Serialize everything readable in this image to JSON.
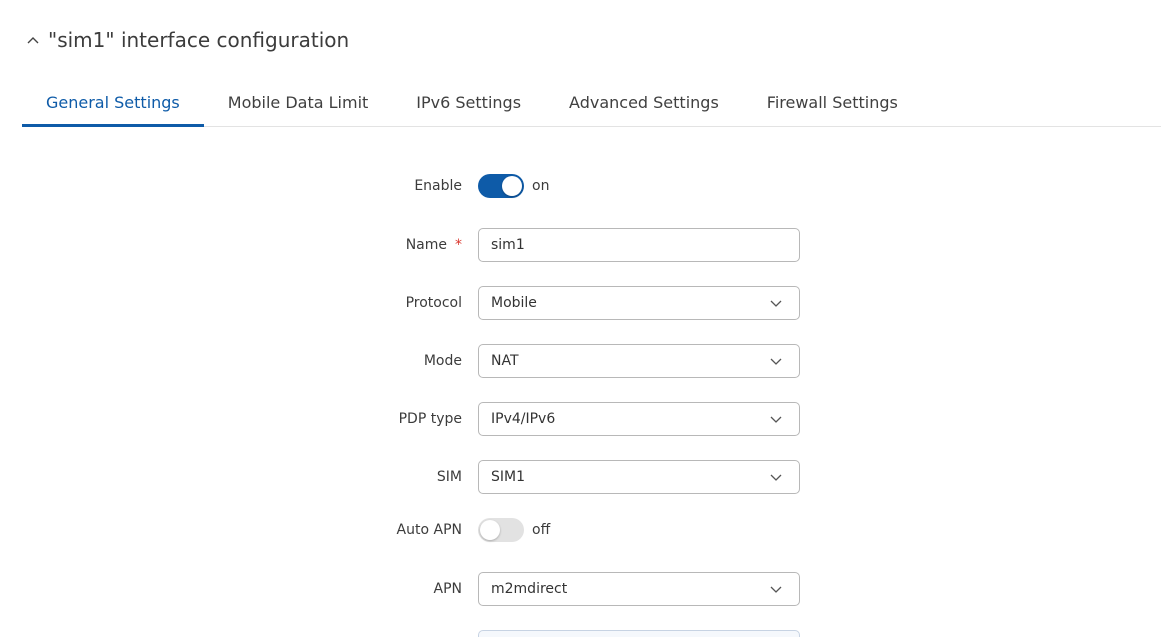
{
  "section": {
    "title": "\"sim1\" interface configuration",
    "collapse_icon": "chevron-up-icon"
  },
  "tabs": [
    {
      "label": "General Settings",
      "active": true
    },
    {
      "label": "Mobile Data Limit",
      "active": false
    },
    {
      "label": "IPv6 Settings",
      "active": false
    },
    {
      "label": "Advanced Settings",
      "active": false
    },
    {
      "label": "Firewall Settings",
      "active": false
    }
  ],
  "form": {
    "enable": {
      "label": "Enable",
      "state": "on"
    },
    "name": {
      "label": "Name",
      "required_mark": "*",
      "value": "sim1"
    },
    "protocol": {
      "label": "Protocol",
      "value": "Mobile"
    },
    "mode": {
      "label": "Mode",
      "value": "NAT"
    },
    "pdp_type": {
      "label": "PDP type",
      "value": "IPv4/IPv6"
    },
    "sim": {
      "label": "SIM",
      "value": "SIM1"
    },
    "auto_apn": {
      "label": "Auto APN",
      "state": "off"
    },
    "apn": {
      "label": "APN",
      "value": "m2mdirect"
    }
  },
  "colors": {
    "accent": "#0e5ba8",
    "required": "#d9342b",
    "toggle_off": "#e2e2e2",
    "border": "#b8b8b8"
  }
}
